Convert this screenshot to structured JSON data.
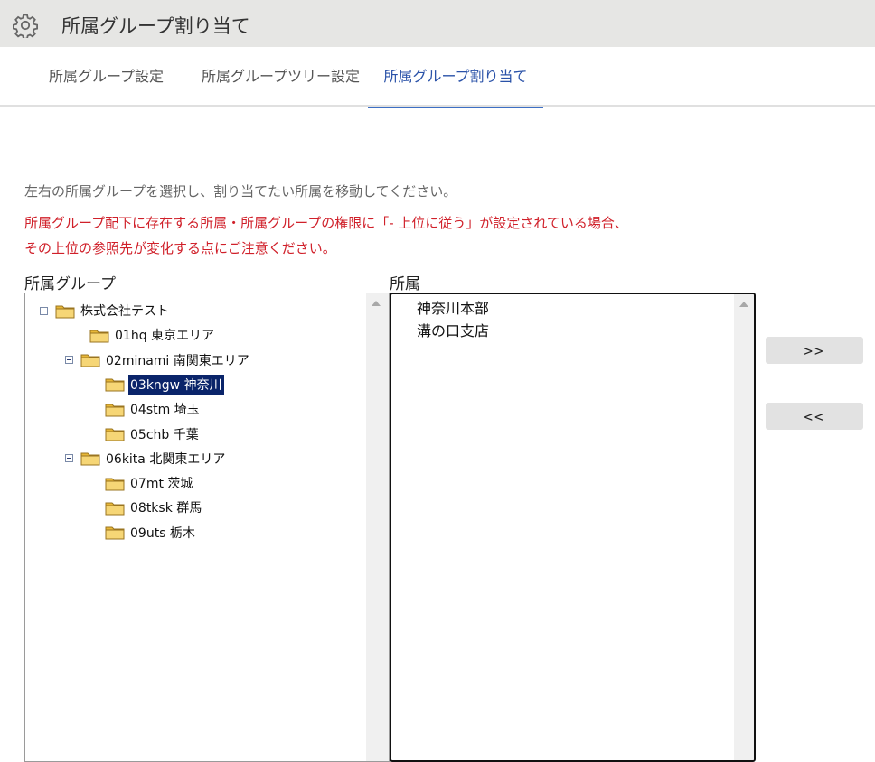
{
  "header": {
    "title": "所属グループ割り当て",
    "icon": "gear-icon"
  },
  "tabs": [
    {
      "label": "所属グループ設定",
      "active": false
    },
    {
      "label": "所属グループツリー設定",
      "active": false
    },
    {
      "label": "所属グループ割り当て",
      "active": true
    }
  ],
  "instructions": {
    "line1": "左右の所属グループを選択し、割り当てたい所属を移動してください。",
    "warning_line1": "所属グループ配下に存在する所属・所属グループの権限に「- 上位に従う」が設定されている場合、",
    "warning_line2": "その上位の参照先が変化する点にご注意ください。"
  },
  "left_panel": {
    "label": "所属グループ",
    "tree": [
      {
        "label": "株式会社テスト",
        "level": 0,
        "expandable": true,
        "selected": false
      },
      {
        "label": "01hq 東京エリア",
        "level": 1,
        "expandable": false,
        "selected": false
      },
      {
        "label": "02minami 南関東エリア",
        "level": 1,
        "expandable": true,
        "selected": false
      },
      {
        "label": "03kngw 神奈川",
        "level": 2,
        "expandable": false,
        "selected": true
      },
      {
        "label": "04stm 埼玉",
        "level": 2,
        "expandable": false,
        "selected": false
      },
      {
        "label": "05chb 千葉",
        "level": 2,
        "expandable": false,
        "selected": false
      },
      {
        "label": "06kita 北関東エリア",
        "level": 1,
        "expandable": true,
        "selected": false
      },
      {
        "label": "07mt 茨城",
        "level": 2,
        "expandable": false,
        "selected": false
      },
      {
        "label": "08tksk 群馬",
        "level": 2,
        "expandable": false,
        "selected": false
      },
      {
        "label": "09uts 栃木",
        "level": 2,
        "expandable": false,
        "selected": false
      }
    ]
  },
  "right_panel": {
    "label": "所属",
    "items": [
      "神奈川本部",
      "溝の口支店"
    ]
  },
  "buttons": {
    "move_right": ">>",
    "move_left": "<<"
  },
  "colors": {
    "header_bg": "#e6e6e4",
    "active_tab": "#2a52a8",
    "warning": "#d0202a",
    "selection": "#0a246a"
  }
}
